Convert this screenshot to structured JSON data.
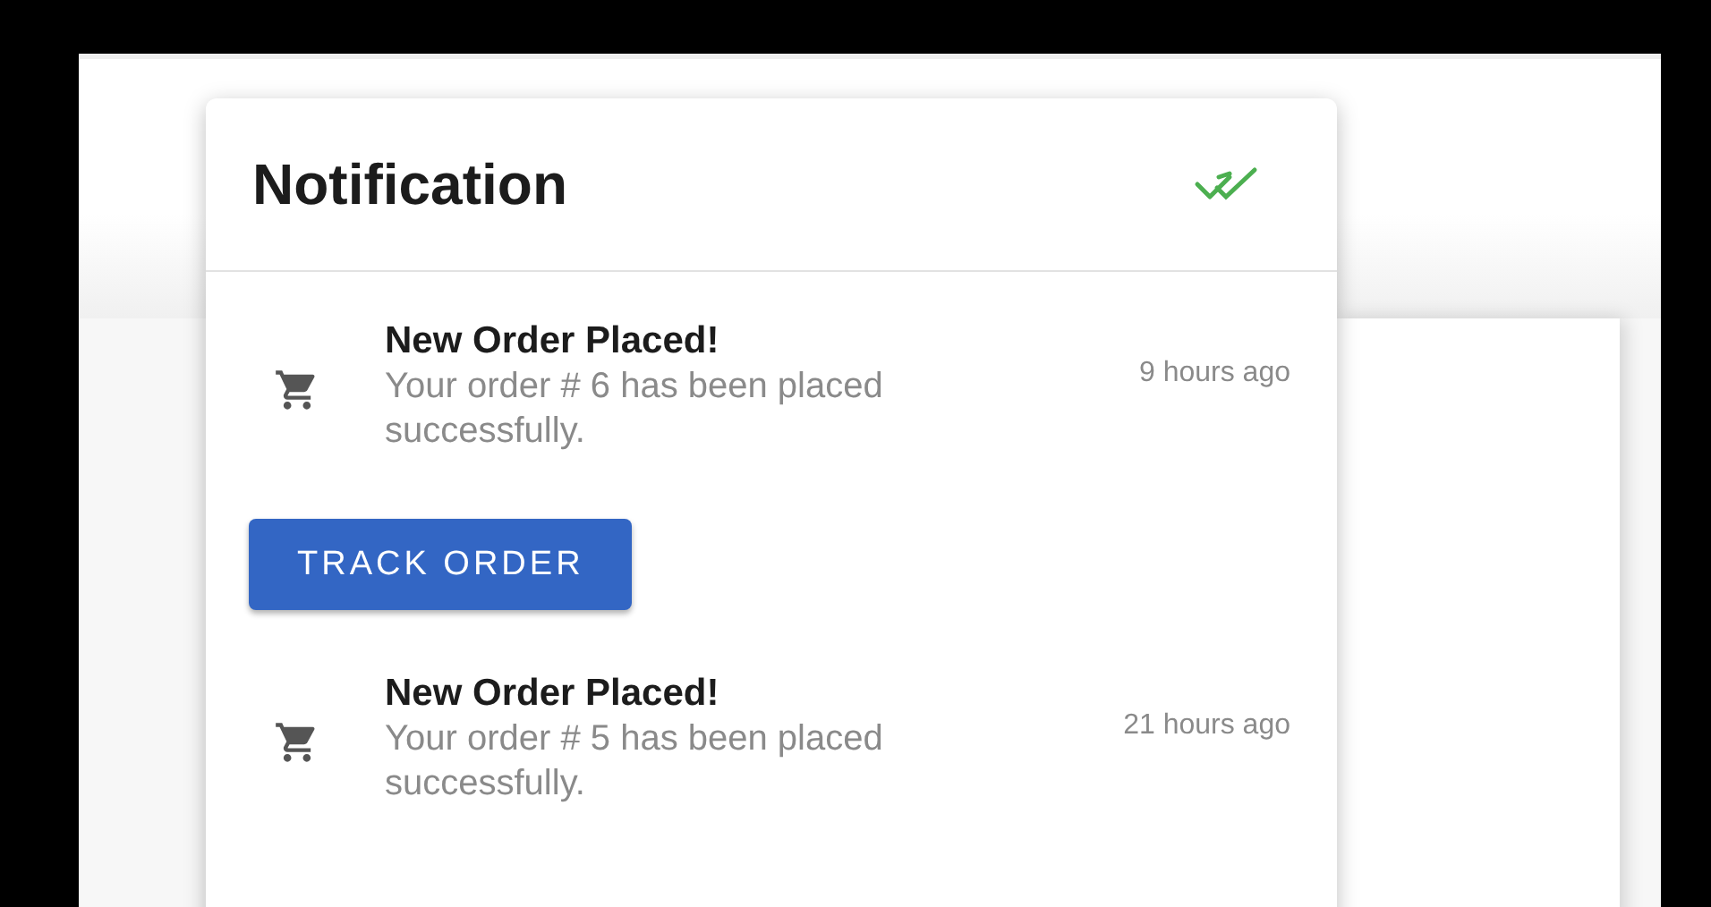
{
  "notification_panel": {
    "title": "Notification",
    "notifications": [
      {
        "title": "New Order Placed!",
        "message": "Your order # 6 has been placed successfully.",
        "time": "9 hours ago",
        "action": "TRACK ORDER"
      },
      {
        "title": "New Order Placed!",
        "message": "Your order # 5 has been placed successfully.",
        "time": "21 hours ago"
      }
    ]
  }
}
